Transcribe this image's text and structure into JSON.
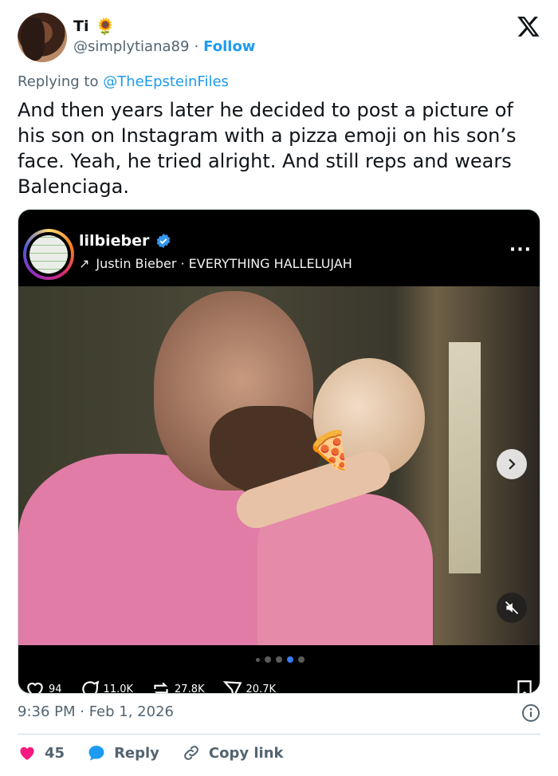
{
  "author": {
    "display_name": "Ti",
    "badge_emoji": "🌻",
    "handle": "@simplytiana89",
    "separator": "·",
    "follow_label": "Follow"
  },
  "reply": {
    "prefix": "Replying to",
    "mention": "@TheEpsteinFiles"
  },
  "tweet": {
    "text": "And then years later he decided to post a picture of his son on Instagram with a pizza emoji on his son’s face. Yeah, he tried alright. And still reps and wears Balenciaga."
  },
  "embed": {
    "username": "lilbieber",
    "audio_arrow": "↗",
    "audio_label": "Justin Bieber · EVERYTHING HALLELUJAH",
    "more_label": "···",
    "sticker_emoji": "🍕",
    "carousel_dots": 5,
    "carousel_active_index": 3,
    "actions_partial": [
      "94",
      "11.0K",
      "27.8K",
      "20.7K"
    ]
  },
  "meta": {
    "timestamp": "9:36 PM · Feb 1, 2026"
  },
  "actions": {
    "likes": "45",
    "reply_label": "Reply",
    "copy_label": "Copy link"
  },
  "colors": {
    "accent": "#1d9bf0",
    "like": "#f91880",
    "text_secondary": "#536471"
  }
}
